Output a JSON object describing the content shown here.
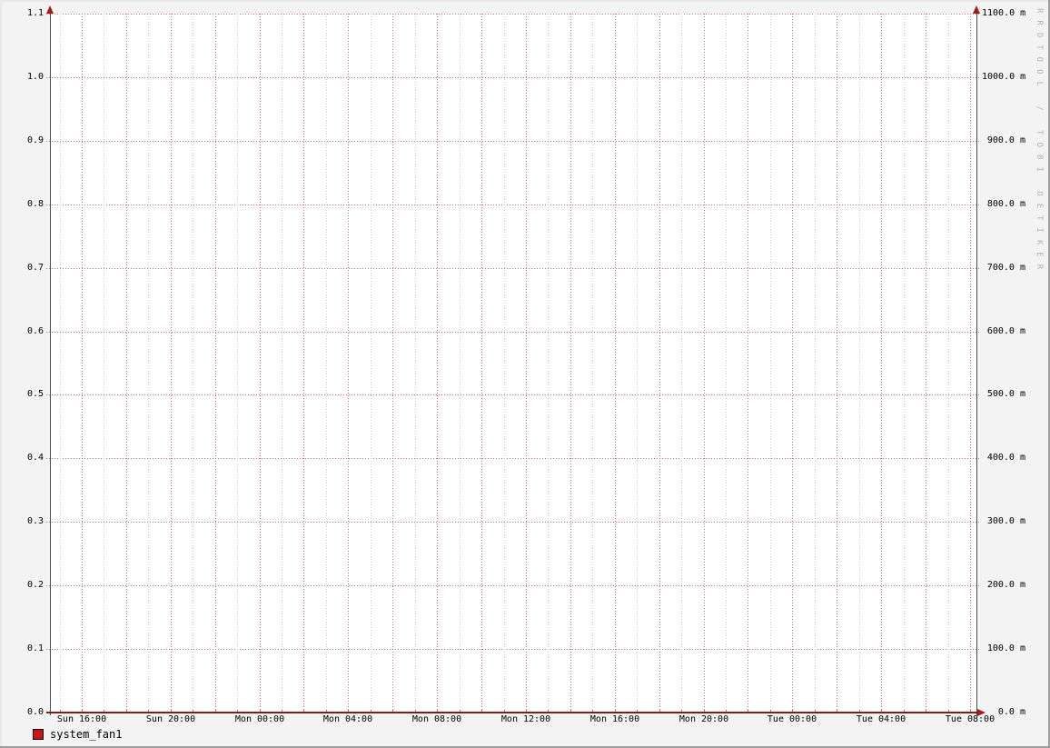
{
  "watermark": "RRDTOOL / TOBI OETIKER",
  "legend": {
    "items": [
      {
        "label": "system_fan1",
        "color": "#cc1414"
      }
    ]
  },
  "colors": {
    "background": "#f3f3f3",
    "canvas": "#ffffff",
    "major_grid": "#d46a6a",
    "minor_grid": "#cccccc",
    "axis": "#4f4f4f",
    "x_axis_line": "#7c1f1f",
    "arrow": "#a51c1c",
    "series_red": "#cc1414",
    "watermark_gray": "#b3b3b3"
  },
  "chart_data": {
    "type": "line",
    "title": "",
    "series": [
      {
        "name": "system_fan1",
        "color": "#cc1414",
        "x": [
          "Sun 14:35",
          "Tue 08:15"
        ],
        "values": [
          0,
          0
        ],
        "note": "flat line at 0 along the entire x-axis"
      }
    ],
    "x_axis": {
      "tick_labels": [
        "Sun 16:00",
        "Sun 20:00",
        "Mon 00:00",
        "Mon 04:00",
        "Mon 08:00",
        "Mon 12:00",
        "Mon 16:00",
        "Mon 20:00",
        "Tue 00:00",
        "Tue 04:00",
        "Tue 08:00"
      ],
      "minor_grid_every": "1 hour",
      "major_grid_every": "2 hours",
      "label_every": "4 hours"
    },
    "left_axis": {
      "tick_labels": [
        "0.0",
        "0.1",
        "0.2",
        "0.3",
        "0.4",
        "0.5",
        "0.6",
        "0.7",
        "0.8",
        "0.9",
        "1.0",
        "1.1"
      ],
      "range": [
        0.0,
        1.1
      ]
    },
    "right_axis": {
      "tick_labels": [
        "0.0 m",
        "100.0 m",
        "200.0 m",
        "300.0 m",
        "400.0 m",
        "500.0 m",
        "600.0 m",
        "700.0 m",
        "800.0 m",
        "900.0 m",
        "1000.0 m",
        "1100.0 m"
      ],
      "range": [
        0,
        1100
      ],
      "unit": "m"
    },
    "grid": "major horizontal red dotted every 0.1 / 100 m; vertical red dotted every 2 h with gray dotted hourly minors",
    "legend_position": "bottom-left"
  }
}
